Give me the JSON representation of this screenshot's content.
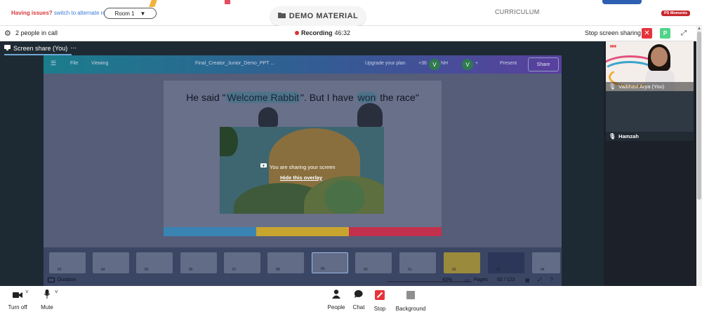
{
  "topbar": {
    "issues_text": "Having issues?",
    "switch_text": "switch to alternate room",
    "room_label": "Room 1",
    "demo_tab_label": "DEMO MATERIAL",
    "curriculum_label": "CURRICULUM",
    "ps_badge": "PS Moments"
  },
  "callbar": {
    "people_count": "2 people in call",
    "recording_label": "Recording",
    "recording_time": "46:32",
    "stop_share_label": "Stop screen sharing",
    "p_label": "P"
  },
  "stage": {
    "tab_label": "Screen share (You)",
    "tab_more": "⋯"
  },
  "canva": {
    "file_label": "File",
    "viewing_label": "Viewing",
    "doc_title": "Final_Creator_Junior_Demo_PPT ...",
    "upgrade_label": "Upgrade your plan",
    "collab_count": "+36",
    "avatars": [
      "V",
      "NH",
      "V"
    ],
    "present_label": "Present",
    "share_label": "Share",
    "slide_title_parts": [
      "He said \"",
      "Welcome Rabbit",
      "\". But I have ",
      "won",
      " the race\""
    ],
    "overlay_message": "You are sharing your screen",
    "overlay_hide": "Hide this overlay",
    "thumb_numbers": [
      "83",
      "84",
      "85",
      "86",
      "87",
      "88",
      "89",
      "90",
      "91",
      "92",
      "93",
      "94"
    ],
    "duration_label": "Duration",
    "zoom": "43%",
    "pages_label": "Pages",
    "page_counter": "92 / 123",
    "help_label": "?"
  },
  "participants": [
    {
      "name": "Vaibhavi Arya (You)",
      "muted": false
    },
    {
      "name": "Hamzah",
      "muted": false
    }
  ],
  "controls": {
    "camera_label": "Turn off",
    "mute_label": "Mute",
    "people_label": "People",
    "chat_label": "Chat",
    "stop_label": "Stop",
    "background_label": "Background"
  },
  "colors": {
    "accent_red": "#e5343b",
    "accent_green": "#52d38a",
    "stage_bg": "#1e2a33"
  },
  "icons": {
    "folder": "folder-icon",
    "gear": "gear-icon",
    "camera": "camera-icon",
    "mic": "mic-icon",
    "people": "people-icon",
    "chat": "chat-icon",
    "stop": "stop-share-icon",
    "background": "background-icon"
  }
}
